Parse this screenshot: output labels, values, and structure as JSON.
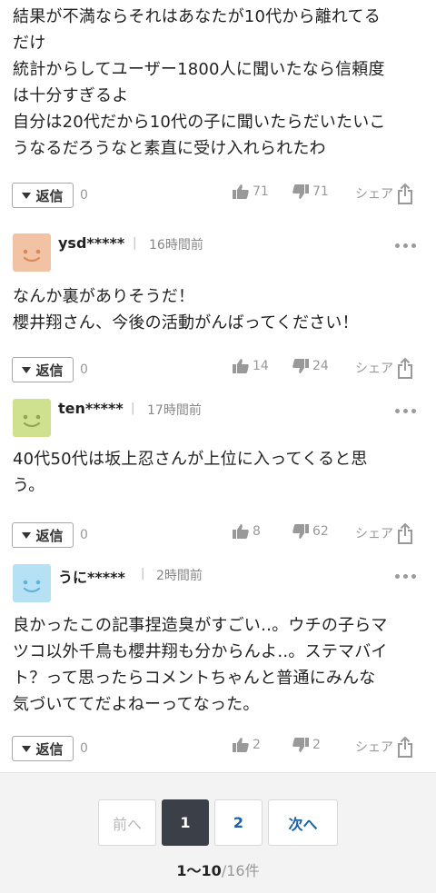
{
  "labels": {
    "reply": "返信",
    "share": "シェア"
  },
  "first_comment": {
    "lines": [
      "結果が不満ならそれはあなたが10代から離れてる",
      "だけ",
      "統計からしてユーザー1800人に聞いたなら信頼度",
      "は十分すぎるよ",
      "自分は20代だから10代の子に聞いたらだいたいこ",
      "うなるだろうなと素直に受け入れられたわ"
    ],
    "replies": "0",
    "likes": "71",
    "dislikes": "71"
  },
  "comments": [
    {
      "user": "ysd*****",
      "time": "16時間前",
      "avatar_color": "#f1c3a4",
      "lines": [
        "なんか裏がありそうだ！",
        "櫻井翔さん、今後の活動がんばってください！"
      ],
      "replies": "0",
      "likes": "14",
      "dislikes": "24"
    },
    {
      "user": "ten*****",
      "time": "17時間前",
      "avatar_color": "#cfe08f",
      "lines": [
        "40代50代は坂上忍さんが上位に入ってくると思",
        "う。"
      ],
      "replies": "0",
      "likes": "8",
      "dislikes": "62"
    },
    {
      "user": "うに*****",
      "time": "2時間前",
      "avatar_color": "#b6e0f3",
      "lines": [
        "良かったこの記事捏造臭がすごい‥。ウチの子らマ",
        "ツコ以外千鳥も櫻井翔も分からんよ‥。ステマバイ",
        "ト？って思ったらコメントちゃんと普通にみんな",
        "気づいててだよねーってなった。"
      ],
      "replies": "0",
      "likes": "2",
      "dislikes": "2"
    }
  ],
  "pagination": {
    "prev": "前へ",
    "current": "1",
    "page2": "2",
    "next": "次へ",
    "range": "1〜10",
    "total": "/16件"
  }
}
